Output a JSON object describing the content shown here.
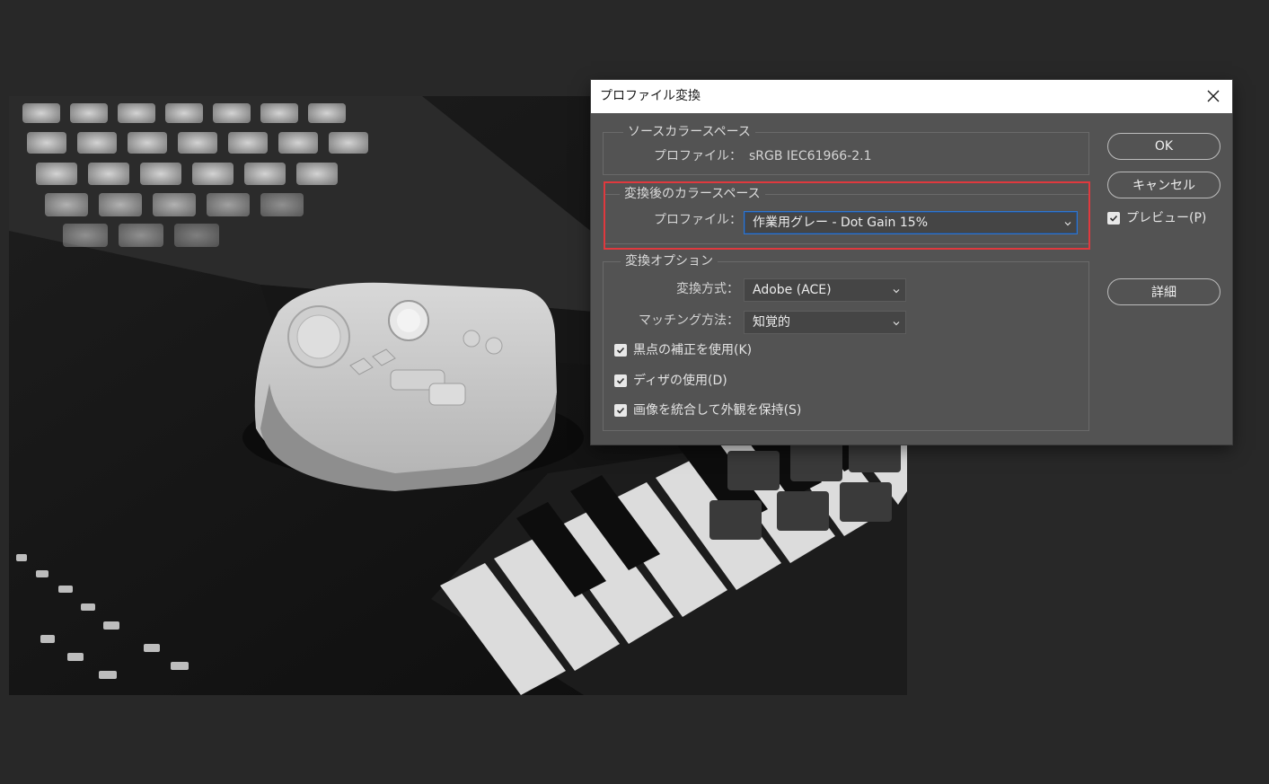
{
  "dialog": {
    "title": "プロファイル変換",
    "source": {
      "legend": "ソースカラースペース",
      "profile_label": "プロファイル：",
      "profile_value": "sRGB IEC61966-2.1"
    },
    "destination": {
      "legend": "変換後のカラースペース",
      "profile_label": "プロファイル：",
      "profile_value": "作業用グレー - Dot Gain 15%"
    },
    "options": {
      "legend": "変換オプション",
      "engine_label": "変換方式：",
      "engine_value": "Adobe (ACE)",
      "intent_label": "マッチング方法：",
      "intent_value": "知覚的",
      "checkboxes": [
        {
          "label": "黒点の補正を使用(K)",
          "checked": true
        },
        {
          "label": "ディザの使用(D)",
          "checked": true
        },
        {
          "label": "画像を統合して外観を保持(S)",
          "checked": true
        }
      ]
    },
    "buttons": {
      "ok": "OK",
      "cancel": "キャンセル",
      "advanced": "詳細"
    },
    "preview": {
      "label": "プレビュー(P)",
      "checked": true
    }
  },
  "colors": {
    "highlight": "#e0393e",
    "focus": "#2f76d2",
    "dialog_bg": "#535353",
    "workspace_bg": "#282828"
  }
}
